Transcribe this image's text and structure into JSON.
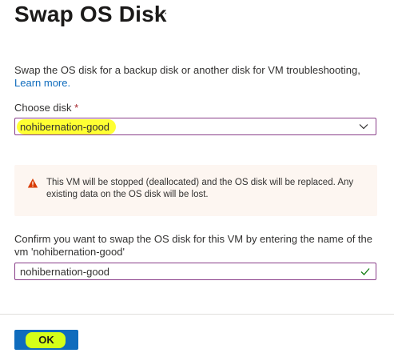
{
  "panel": {
    "title": "Swap OS Disk",
    "more_label": "···",
    "description": "Swap the OS disk for a backup disk or another disk for VM troubleshooting,",
    "learn_more": "Learn more."
  },
  "choose_disk": {
    "label": "Choose disk",
    "required_mark": "*",
    "selected_value": "nohibernation-good",
    "chevron_icon": "chevron-down-icon"
  },
  "warning": {
    "icon": "warning-icon",
    "text": "This VM will be stopped (deallocated) and the OS disk will be replaced. Any existing data on the OS disk will be lost.",
    "color": "#fdf6f1",
    "icon_color": "#d83b01"
  },
  "confirm": {
    "label": "Confirm you want to swap the OS disk for this VM by entering the name of the vm 'nohibernation-good'",
    "value": "nohibernation-good",
    "valid_icon": "check-icon",
    "valid_color": "#107c10"
  },
  "footer": {
    "ok_label": "OK"
  },
  "colors": {
    "accent": "#0f6cbd",
    "field_border": "#8a3f8a",
    "highlight_yellow": "#ffff33",
    "highlight_green": "#d4ff18"
  }
}
